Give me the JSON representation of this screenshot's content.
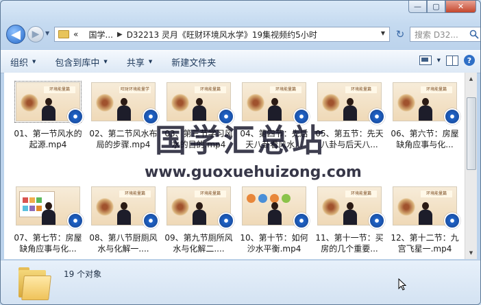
{
  "window": {
    "caption": {
      "minimize": "—",
      "maximize": "▢",
      "close": "✕"
    }
  },
  "nav": {
    "back_glyph": "◀",
    "forward_glyph": "▶",
    "path_prefix": "«",
    "path_segments": [
      "国学...",
      "D32213 灵月《旺财环境风水学》19集视频约5小时"
    ],
    "refresh_glyph": "↻",
    "search_placeholder": "搜索 D32..."
  },
  "toolbar": {
    "items": [
      {
        "label": "组织",
        "has_menu": true
      },
      {
        "label": "包含到库中",
        "has_menu": true
      },
      {
        "label": "共享",
        "has_menu": true
      },
      {
        "label": "新建文件夹",
        "has_menu": false
      }
    ],
    "help_glyph": "?"
  },
  "files": [
    {
      "label": "01、第一节风水的起源.mp4",
      "thumb": "study",
      "thumb_title": "环境能量篇"
    },
    {
      "label": "02、第二节风水布局的步骤.mp4",
      "thumb": "study",
      "thumb_title": "旺财环境能量学"
    },
    {
      "label": "03、第三节学习风水的目的.mp4",
      "thumb": "study",
      "thumb_title": "环境能量篇"
    },
    {
      "label": "04、第四节：先后天八卦看风水...",
      "thumb": "study",
      "thumb_title": "环境能量篇"
    },
    {
      "label": "05、第五节：先天八卦与后天八...",
      "thumb": "study",
      "thumb_title": "环境能量篇"
    },
    {
      "label": "06、第六节：房屋缺角应事与化...",
      "thumb": "study",
      "thumb_title": "环境能量篇"
    },
    {
      "label": "07、第七节：房屋缺角应事与化...",
      "thumb": "panel",
      "thumb_title": ""
    },
    {
      "label": "08、第八节厨厕风水与化解一....",
      "thumb": "study",
      "thumb_title": "环境能量篇"
    },
    {
      "label": "09、第九节厕所风水与化解二....",
      "thumb": "study",
      "thumb_title": "环境能量篇"
    },
    {
      "label": "10、第十节：如何沙水平衡.mp4",
      "thumb": "circles",
      "thumb_title": ""
    },
    {
      "label": "11、第十一节：买房的几个重要...",
      "thumb": "study",
      "thumb_title": "环境能量篇"
    },
    {
      "label": "12、第十二节：九宫飞星一.mp4",
      "thumb": "study",
      "thumb_title": "环境能量篇"
    }
  ],
  "watermark": {
    "chinese": "国学汇总站",
    "url": "www.guoxuehuizong.com"
  },
  "status": {
    "count_text": "19 个对象"
  },
  "colors": {
    "accent": "#1f63c8",
    "thumb_bg": "#efd9b7"
  }
}
